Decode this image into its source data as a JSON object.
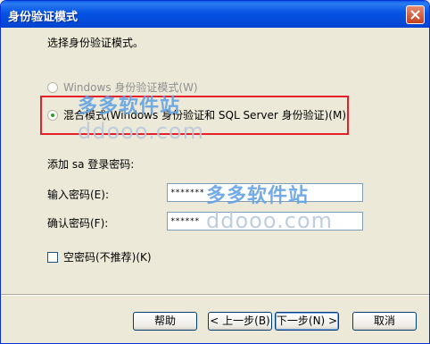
{
  "window": {
    "title": "身份验证模式"
  },
  "dialog": {
    "prompt": "选择身份验证模式。",
    "options": [
      {
        "label": "Windows 身份验证模式(W)",
        "selected": false,
        "enabled": false
      },
      {
        "label": "混合模式(Windows 身份验证和 SQL Server 身份验证)(M)",
        "selected": true,
        "enabled": true
      }
    ],
    "sa_section_label": "添加 sa 登录密码:",
    "password_label": "输入密码(E):",
    "password_value": "*******",
    "confirm_label": "确认密码(F):",
    "confirm_value": "******",
    "empty_password_label": "空密码(不推荐)(K)",
    "empty_password_checked": false
  },
  "buttons": {
    "help": "帮助",
    "back": "< 上一步(B)",
    "next": "下一步(N) >",
    "cancel": "取消"
  },
  "watermarks": [
    {
      "brand": "多多软件站",
      "domain": "ddooo.com"
    },
    {
      "brand": "多多软件站",
      "domain": "ddooo.com"
    }
  ],
  "colors": {
    "titlebar": "#0553e3",
    "highlight": "#e6202b",
    "dialog_bg": "#ece9d8"
  }
}
